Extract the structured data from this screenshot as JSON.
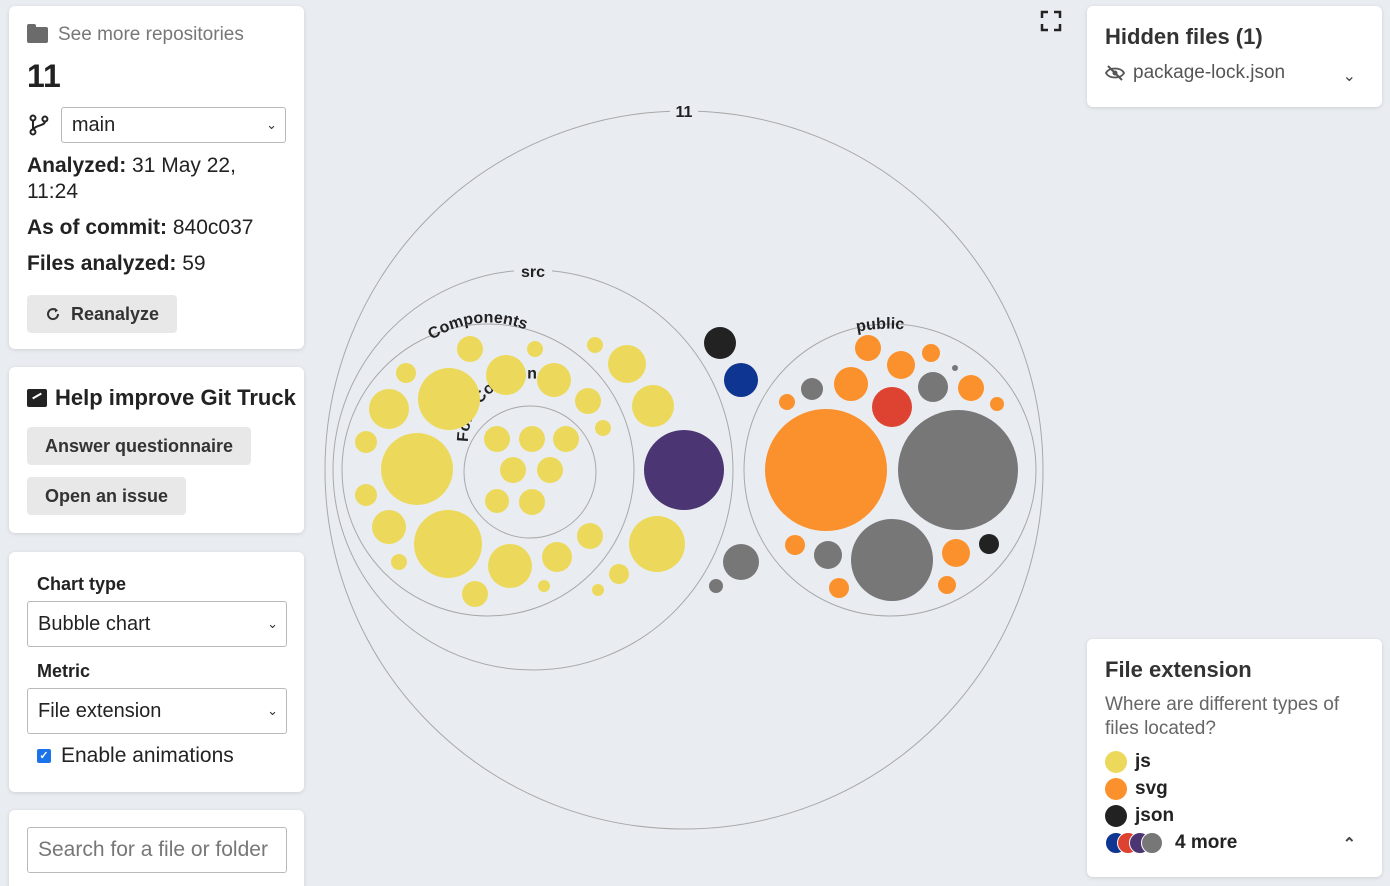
{
  "sidebar": {
    "more_repos": "See more repositories",
    "repo_name": "11",
    "branch": "main",
    "analyzed_label": "Analyzed:",
    "analyzed_value": " 31 May 22, 11:24",
    "commit_label": "As of commit:",
    "commit_value": " 840c037",
    "files_label": "Files analyzed:",
    "files_value": " 59",
    "reanalyze": "Reanalyze"
  },
  "help": {
    "title": "Help improve Git Truck",
    "questionnaire": "Answer questionnaire",
    "issue": "Open an issue"
  },
  "settings": {
    "chart_type_label": "Chart type",
    "chart_type_value": "Bubble chart",
    "metric_label": "Metric",
    "metric_value": "File extension",
    "animations_label": "Enable animations"
  },
  "search": {
    "placeholder": "Search for a file or folder"
  },
  "hidden_files": {
    "title": "Hidden files (1)",
    "items": [
      "package-lock.json"
    ]
  },
  "legend": {
    "title": "File extension",
    "description": "Where are different types of files located?",
    "items": [
      {
        "label": "js",
        "color": "#ecd95c"
      },
      {
        "label": "svg",
        "color": "#fb912d"
      },
      {
        "label": "json",
        "color": "#222222"
      }
    ],
    "more": "4 more",
    "more_colors": [
      "#0f3592",
      "#de4230",
      "#4b3572",
      "#777777"
    ]
  },
  "chart_data": {
    "type": "bubble",
    "labels": {
      "root": "11",
      "src": "src",
      "components": "Components",
      "form_components": "FormComponents",
      "public": "public"
    }
  },
  "colors": {
    "js": "#ecd95c",
    "svg": "#fb912d",
    "json": "#222222",
    "blue": "#0f3592",
    "purple": "#4b3572",
    "red": "#de4230",
    "gray": "#777777"
  }
}
